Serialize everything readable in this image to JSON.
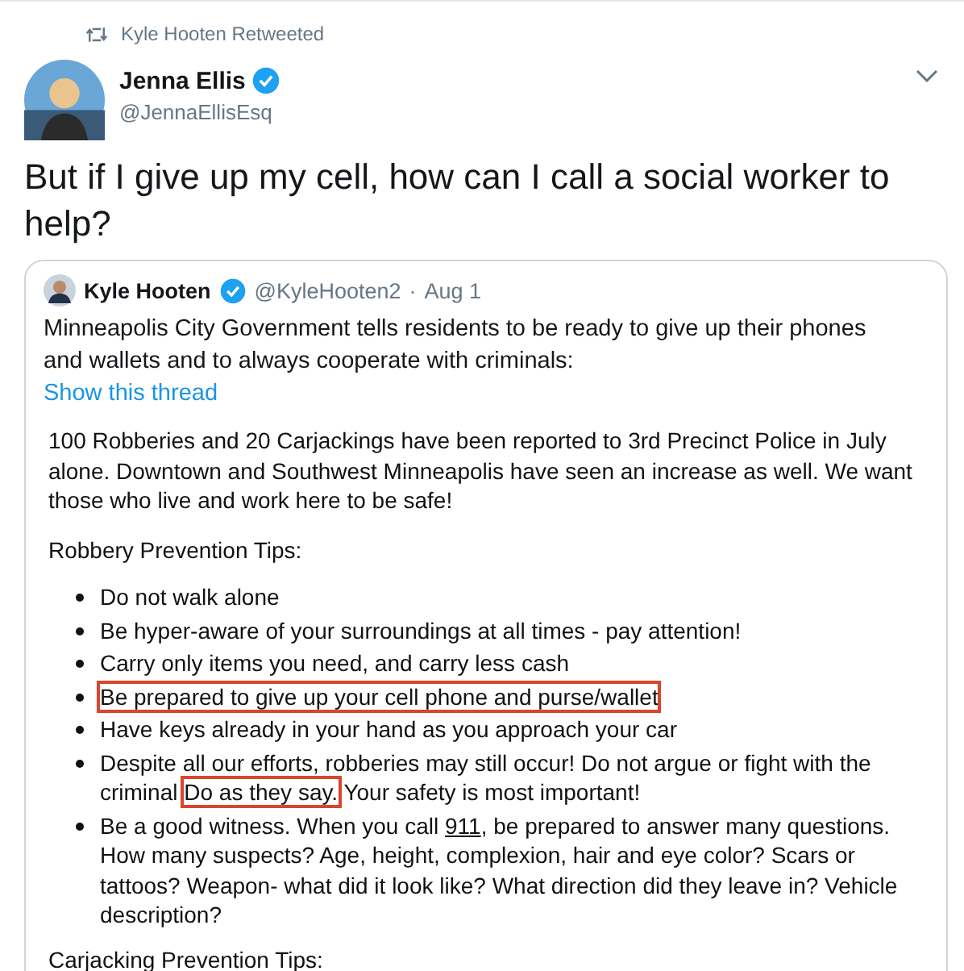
{
  "retweet_label": "Kyle Hooten Retweeted",
  "tweet": {
    "name": "Jenna Ellis",
    "verified": true,
    "handle": "@JennaEllisEsq",
    "text": "But if I give up my cell, how can I call a social worker to help?"
  },
  "quoted_tweet": {
    "name": "Kyle Hooten",
    "verified": true,
    "handle": "@KyleHooten2",
    "separator": "·",
    "date": "Aug 1",
    "text": "Minneapolis City Government tells residents to be ready to give up their phones and wallets and to always cooperate with criminals:",
    "thread_link": "Show this thread",
    "document": {
      "intro": "100 Robberies and 20 Carjackings have been reported to 3rd Precinct Police in July alone. Downtown and Southwest Minneapolis have seen an increase as well. We want those who live and work here to be safe!",
      "heading": "Robbery Prevention Tips:",
      "bullets": [
        [
          {
            "kind": "plain",
            "text": "Do not walk alone"
          }
        ],
        [
          {
            "kind": "plain",
            "text": "Be hyper-aware of your surroundings at all times - pay attention!"
          }
        ],
        [
          {
            "kind": "plain",
            "text": "Carry only items you need, and carry less cash"
          }
        ],
        [
          {
            "kind": "highlighted",
            "text": "Be prepared to give up your cell phone and purse/wallet"
          }
        ],
        [
          {
            "kind": "plain",
            "text": "Have keys already in your hand as you approach your car"
          }
        ],
        [
          {
            "kind": "plain",
            "text": "Despite all our efforts, robberies may still occur! Do not argue or fight with the criminal "
          },
          {
            "kind": "highlighted",
            "text": "Do as they say."
          },
          {
            "kind": "plain",
            "text": " Your safety is most important!"
          }
        ],
        [
          {
            "kind": "plain",
            "text": "Be a good witness. When you call "
          },
          {
            "kind": "underlined",
            "text": "911"
          },
          {
            "kind": "plain",
            "text": ", be prepared to answer many questions. How many suspects? Age, height, complexion, hair and eye color? Scars or tattoos? Weapon- what did it look like? What direction did they leave in? Vehicle description?"
          }
        ]
      ],
      "next_heading": "Carjacking Prevention Tips:"
    }
  }
}
